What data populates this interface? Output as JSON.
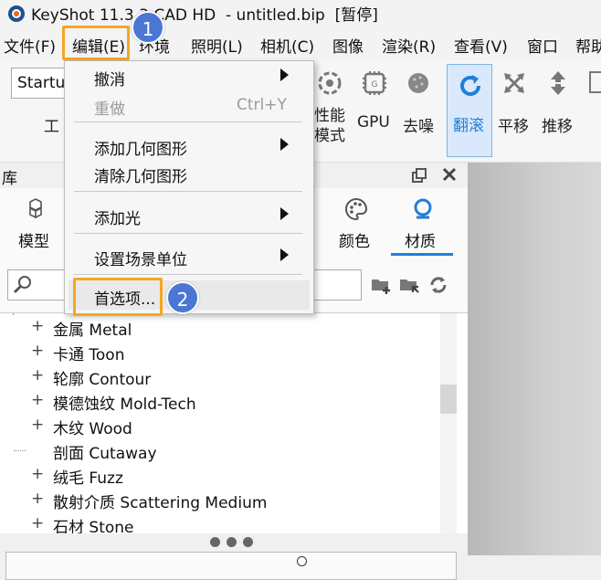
{
  "window": {
    "title": "KeyShot 11.3.3 CAD HD  - untitled.bip  [暂停]"
  },
  "menubar": [
    "文件(F)",
    "编辑(E)",
    "环境",
    "照明(L)",
    "相机(C)",
    "图像",
    "渲染(R)",
    "查看(V)",
    "窗口",
    "帮助"
  ],
  "toolbar": {
    "startup_value": "Startu",
    "work_label": "工",
    "performance_label_1": "性能",
    "performance_label_2": "模式",
    "gpu_label": "GPU",
    "denoise_label": "去噪",
    "tumble_label": "翻滚",
    "pan_label": "平移",
    "dolly_label": "推移"
  },
  "library": {
    "title": "库",
    "tabs": {
      "model": "模型",
      "color": "颜色",
      "material": "材质"
    },
    "tree": [
      {
        "expander": "+",
        "label": "金属 Metal"
      },
      {
        "expander": "+",
        "label": "卡通 Toon"
      },
      {
        "expander": "+",
        "label": "轮廓 Contour"
      },
      {
        "expander": "+",
        "label": "模德蚀纹 Mold-Tech"
      },
      {
        "expander": "+",
        "label": "木纹 Wood"
      },
      {
        "expander": "",
        "label": "剖面 Cutaway"
      },
      {
        "expander": "+",
        "label": "绒毛 Fuzz"
      },
      {
        "expander": "+",
        "label": "散射介质 Scattering Medium"
      },
      {
        "expander": "+",
        "label": "石材 Stone"
      }
    ]
  },
  "edit_menu": {
    "undo": "撤消",
    "redo": "重做",
    "redo_shortcut": "Ctrl+Y",
    "add_geometry": "添加几何图形",
    "clear_geometry": "清除几何图形",
    "add_light": "添加光",
    "scene_units": "设置场景单位",
    "preferences": "首选项..."
  },
  "callouts": {
    "step1": "1",
    "step2": "2"
  },
  "colors": {
    "accent": "#1f7fd6",
    "callout_border": "#f5a623",
    "badge": "#4a77d4"
  }
}
